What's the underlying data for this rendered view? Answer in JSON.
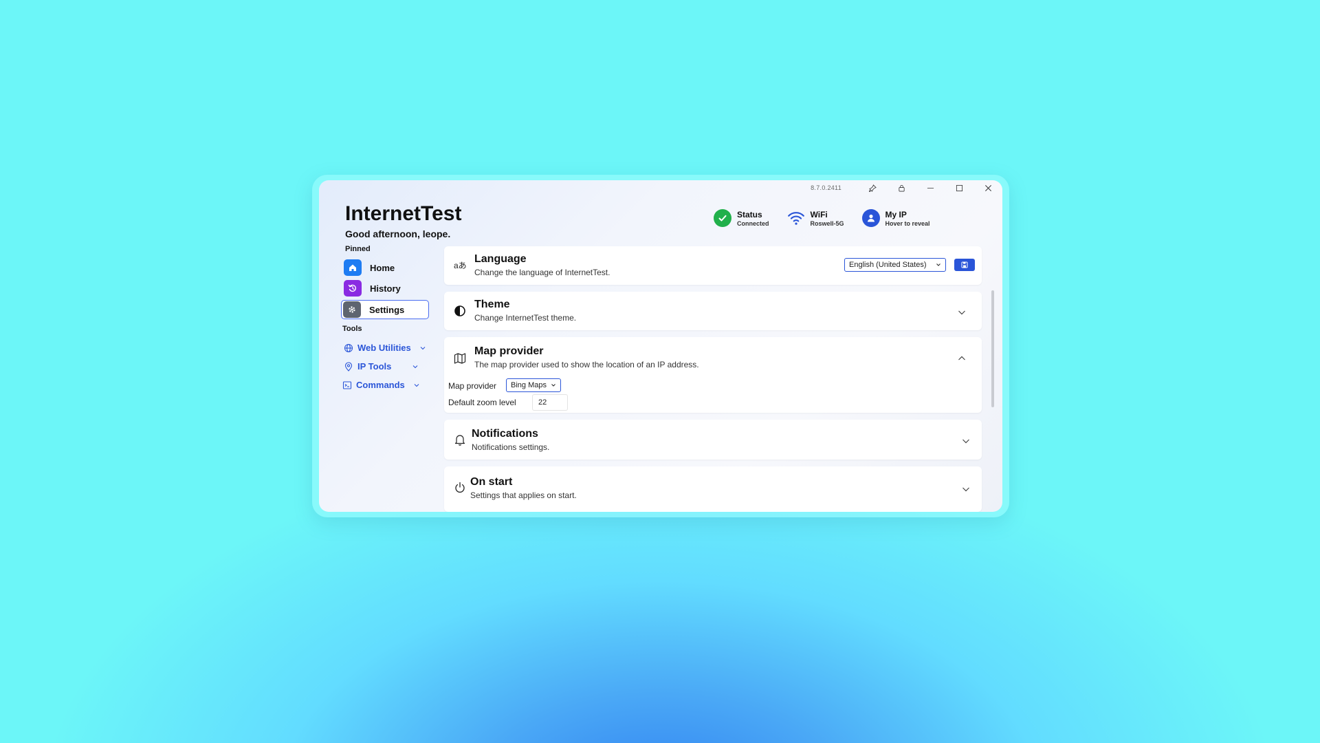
{
  "window": {
    "version": "8.7.0.2411",
    "app_title": "InternetTest",
    "greeting": "Good afternoon, leope."
  },
  "status": [
    {
      "title": "Status",
      "sub": "Connected",
      "icon": "check-circle-icon",
      "color": "#21b04b"
    },
    {
      "title": "WiFi",
      "sub": "Roswell-5G",
      "icon": "wifi-icon",
      "color": "#2a55d8"
    },
    {
      "title": "My IP",
      "sub": "Hover to reveal",
      "icon": "user-location-icon",
      "color": "#2a55d8"
    }
  ],
  "sidebar": {
    "pinned_label": "Pinned",
    "pinned": [
      {
        "label": "Home",
        "icon": "home-icon",
        "color": "#1e7cf2"
      },
      {
        "label": "History",
        "icon": "history-icon",
        "color": "#8a2be2"
      },
      {
        "label": "Settings",
        "icon": "gear-icon",
        "color": "#5e6470",
        "active": true
      }
    ],
    "tools_label": "Tools",
    "tools": [
      {
        "label": "Web Utilities",
        "icon": "globe-icon"
      },
      {
        "label": "IP Tools",
        "icon": "ip-pin-icon"
      },
      {
        "label": "Commands",
        "icon": "terminal-icon"
      }
    ]
  },
  "settings": {
    "language": {
      "title": "Language",
      "desc": "Change the language of InternetTest.",
      "selected": "English (United States)"
    },
    "theme": {
      "title": "Theme",
      "desc": "Change InternetTest theme."
    },
    "map": {
      "title": "Map provider",
      "desc": "The map provider used to show the location of an IP address.",
      "provider_label": "Map provider",
      "provider_value": "Bing Maps",
      "zoom_label": "Default zoom level",
      "zoom_value": "22"
    },
    "notifications": {
      "title": "Notifications",
      "desc": "Notifications settings."
    },
    "onstart": {
      "title": "On start",
      "desc": "Settings that applies on start."
    }
  },
  "colors": {
    "accent": "#2a55d8"
  }
}
